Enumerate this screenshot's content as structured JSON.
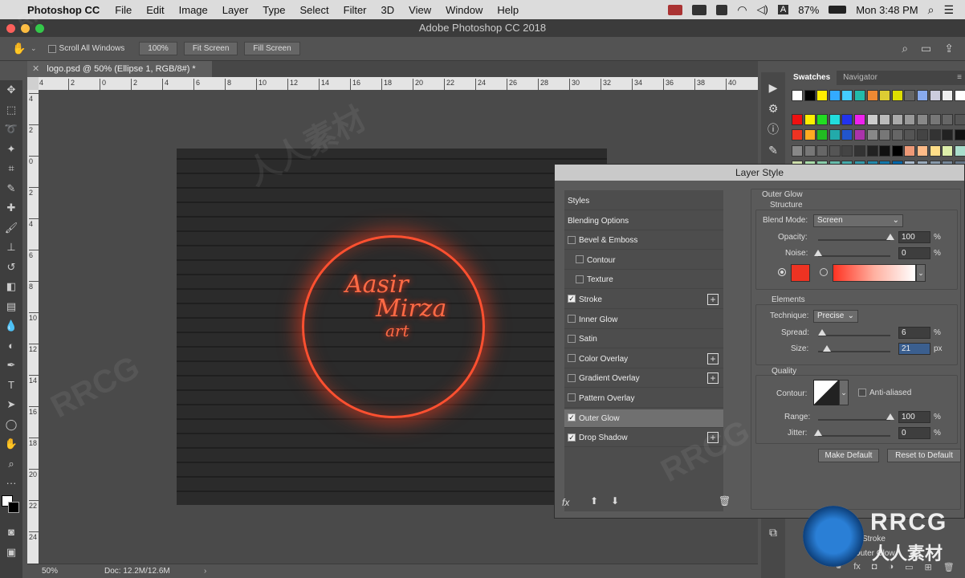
{
  "menubar": {
    "app": "Photoshop CC",
    "items": [
      "File",
      "Edit",
      "Image",
      "Layer",
      "Type",
      "Select",
      "Filter",
      "3D",
      "View",
      "Window",
      "Help"
    ],
    "battery": "87%",
    "clock": "Mon 3:48 PM",
    "input_source": "A"
  },
  "window": {
    "title": "Adobe Photoshop CC 2018"
  },
  "options": {
    "scroll_all": "Scroll All Windows",
    "zoom_btn": "100%",
    "fit_btn": "Fit Screen",
    "fill_btn": "Fill Screen"
  },
  "document": {
    "tab": "logo.psd @ 50% (Ellipse 1, RGB/8#) *",
    "zoom": "50%",
    "doc_size": "Doc: 12.2M/12.6M",
    "signature_line1": "Aasir",
    "signature_line2": "Mirza",
    "signature_line3": "art"
  },
  "ruler": {
    "h_ticks": [
      "4",
      "2",
      "0",
      "2",
      "4",
      "6",
      "8",
      "10",
      "12",
      "14",
      "16",
      "18",
      "20",
      "22",
      "24",
      "26",
      "28",
      "30",
      "32",
      "34",
      "36",
      "38",
      "40"
    ],
    "v_ticks": [
      "4",
      "2",
      "0",
      "2",
      "4",
      "6",
      "8",
      "10",
      "12",
      "14",
      "16",
      "18",
      "20",
      "22",
      "24"
    ]
  },
  "panels": {
    "swatches_tab": "Swatches",
    "navigator_tab": "Navigator",
    "layers_partial1": "Stroke",
    "layers_partial2": "Outer Glow"
  },
  "dialog": {
    "title": "Layer Style",
    "styles": [
      {
        "label": "Styles",
        "check": false,
        "has_check": false,
        "plus": false,
        "indent": false,
        "highlight": false
      },
      {
        "label": "Blending Options",
        "check": false,
        "has_check": false,
        "plus": false,
        "indent": false,
        "highlight": false
      },
      {
        "label": "Bevel & Emboss",
        "check": false,
        "has_check": true,
        "plus": false,
        "indent": false,
        "highlight": false
      },
      {
        "label": "Contour",
        "check": false,
        "has_check": true,
        "plus": false,
        "indent": true,
        "highlight": false
      },
      {
        "label": "Texture",
        "check": false,
        "has_check": true,
        "plus": false,
        "indent": true,
        "highlight": false
      },
      {
        "label": "Stroke",
        "check": true,
        "has_check": true,
        "plus": true,
        "indent": false,
        "highlight": false
      },
      {
        "label": "Inner Glow",
        "check": false,
        "has_check": true,
        "plus": false,
        "indent": false,
        "highlight": false
      },
      {
        "label": "Satin",
        "check": false,
        "has_check": true,
        "plus": false,
        "indent": false,
        "highlight": false
      },
      {
        "label": "Color Overlay",
        "check": false,
        "has_check": true,
        "plus": true,
        "indent": false,
        "highlight": false
      },
      {
        "label": "Gradient Overlay",
        "check": false,
        "has_check": true,
        "plus": true,
        "indent": false,
        "highlight": false
      },
      {
        "label": "Pattern Overlay",
        "check": false,
        "has_check": true,
        "plus": false,
        "indent": false,
        "highlight": false
      },
      {
        "label": "Outer Glow",
        "check": true,
        "has_check": true,
        "plus": false,
        "indent": false,
        "highlight": true
      },
      {
        "label": "Drop Shadow",
        "check": true,
        "has_check": true,
        "plus": true,
        "indent": false,
        "highlight": false
      }
    ],
    "fx": "fx",
    "outer_glow": "Outer Glow",
    "structure": "Structure",
    "blend_mode_label": "Blend Mode:",
    "blend_mode": "Screen",
    "opacity_label": "Opacity:",
    "opacity": "100",
    "opacity_fill": 1.0,
    "noise_label": "Noise:",
    "noise": "0",
    "noise_fill": 0.0,
    "pct": "%",
    "elements": "Elements",
    "technique_label": "Technique:",
    "technique": "Precise",
    "spread_label": "Spread:",
    "spread": "6",
    "spread_fill": 0.06,
    "size_label": "Size:",
    "size": "21",
    "px": "px",
    "quality": "Quality",
    "contour_label": "Contour:",
    "anti_aliased": "Anti-aliased",
    "range_label": "Range:",
    "range": "100",
    "range_fill": 1.0,
    "jitter_label": "Jitter:",
    "jitter": "0",
    "jitter_fill": 0.0,
    "make_default": "Make Default",
    "reset_default": "Reset to Default",
    "glow_color": "#ee3322"
  },
  "watermark": {
    "text1": "RRCG",
    "text2": "人人素材"
  }
}
